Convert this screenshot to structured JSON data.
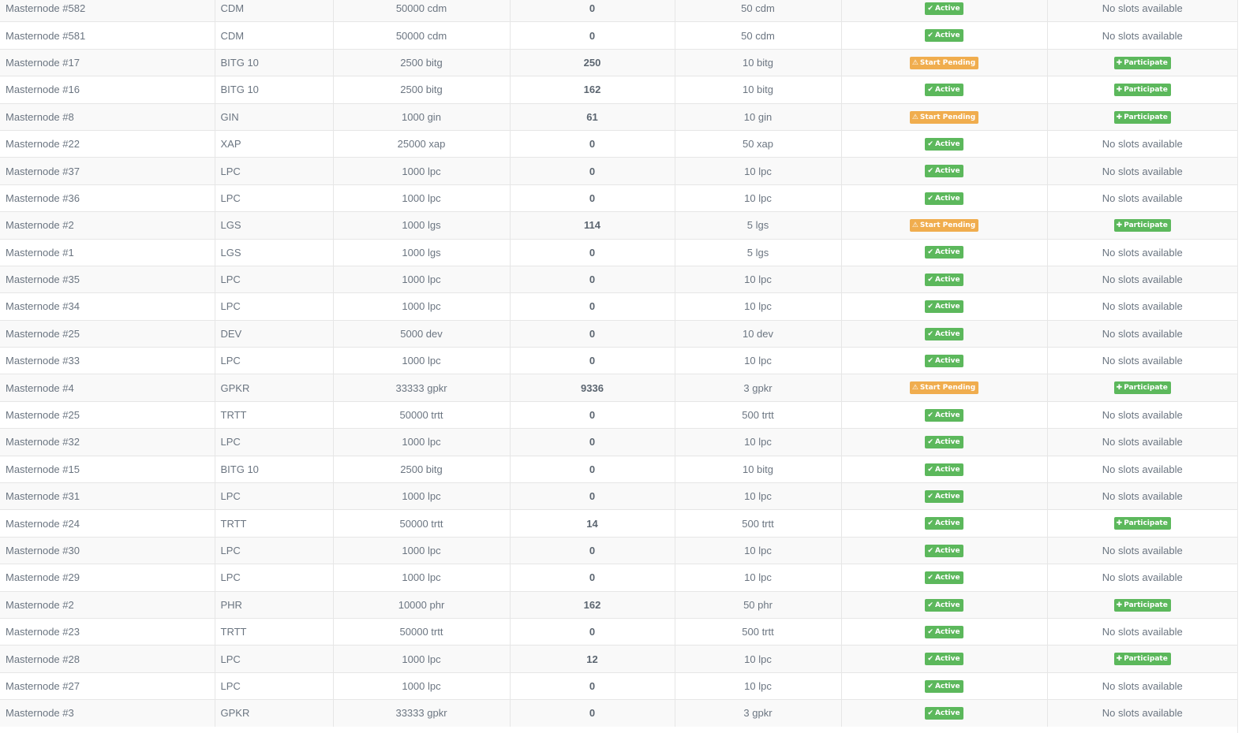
{
  "labels": {
    "active": "Active",
    "start_pending": "Start Pending",
    "participate": "Participate",
    "no_slots": "No slots available"
  },
  "icons": {
    "active": "check-icon",
    "start_pending": "warning-icon",
    "participate": "plus-icon"
  },
  "colors": {
    "active": "#5cb85c",
    "pending": "#f0ad4e",
    "participate": "#5cb85c"
  },
  "rows": [
    {
      "name": "Masternode #582",
      "coin": "CDM",
      "collateral": "50000 cdm",
      "slots": "0",
      "min": "50 cdm",
      "status": "active",
      "action": "none"
    },
    {
      "name": "Masternode #581",
      "coin": "CDM",
      "collateral": "50000 cdm",
      "slots": "0",
      "min": "50 cdm",
      "status": "active",
      "action": "none"
    },
    {
      "name": "Masternode #17",
      "coin": "BITG 10",
      "collateral": "2500 bitg",
      "slots": "250",
      "min": "10 bitg",
      "status": "pending",
      "action": "participate"
    },
    {
      "name": "Masternode #16",
      "coin": "BITG 10",
      "collateral": "2500 bitg",
      "slots": "162",
      "min": "10 bitg",
      "status": "active",
      "action": "participate"
    },
    {
      "name": "Masternode #8",
      "coin": "GIN",
      "collateral": "1000 gin",
      "slots": "61",
      "min": "10 gin",
      "status": "pending",
      "action": "participate"
    },
    {
      "name": "Masternode #22",
      "coin": "XAP",
      "collateral": "25000 xap",
      "slots": "0",
      "min": "50 xap",
      "status": "active",
      "action": "none"
    },
    {
      "name": "Masternode #37",
      "coin": "LPC",
      "collateral": "1000 lpc",
      "slots": "0",
      "min": "10 lpc",
      "status": "active",
      "action": "none"
    },
    {
      "name": "Masternode #36",
      "coin": "LPC",
      "collateral": "1000 lpc",
      "slots": "0",
      "min": "10 lpc",
      "status": "active",
      "action": "none"
    },
    {
      "name": "Masternode #2",
      "coin": "LGS",
      "collateral": "1000 lgs",
      "slots": "114",
      "min": "5 lgs",
      "status": "pending",
      "action": "participate"
    },
    {
      "name": "Masternode #1",
      "coin": "LGS",
      "collateral": "1000 lgs",
      "slots": "0",
      "min": "5 lgs",
      "status": "active",
      "action": "none"
    },
    {
      "name": "Masternode #35",
      "coin": "LPC",
      "collateral": "1000 lpc",
      "slots": "0",
      "min": "10 lpc",
      "status": "active",
      "action": "none"
    },
    {
      "name": "Masternode #34",
      "coin": "LPC",
      "collateral": "1000 lpc",
      "slots": "0",
      "min": "10 lpc",
      "status": "active",
      "action": "none"
    },
    {
      "name": "Masternode #25",
      "coin": "DEV",
      "collateral": "5000 dev",
      "slots": "0",
      "min": "10 dev",
      "status": "active",
      "action": "none"
    },
    {
      "name": "Masternode #33",
      "coin": "LPC",
      "collateral": "1000 lpc",
      "slots": "0",
      "min": "10 lpc",
      "status": "active",
      "action": "none"
    },
    {
      "name": "Masternode #4",
      "coin": "GPKR",
      "collateral": "33333 gpkr",
      "slots": "9336",
      "min": "3 gpkr",
      "status": "pending",
      "action": "participate"
    },
    {
      "name": "Masternode #25",
      "coin": "TRTT",
      "collateral": "50000 trtt",
      "slots": "0",
      "min": "500 trtt",
      "status": "active",
      "action": "none"
    },
    {
      "name": "Masternode #32",
      "coin": "LPC",
      "collateral": "1000 lpc",
      "slots": "0",
      "min": "10 lpc",
      "status": "active",
      "action": "none"
    },
    {
      "name": "Masternode #15",
      "coin": "BITG 10",
      "collateral": "2500 bitg",
      "slots": "0",
      "min": "10 bitg",
      "status": "active",
      "action": "none"
    },
    {
      "name": "Masternode #31",
      "coin": "LPC",
      "collateral": "1000 lpc",
      "slots": "0",
      "min": "10 lpc",
      "status": "active",
      "action": "none"
    },
    {
      "name": "Masternode #24",
      "coin": "TRTT",
      "collateral": "50000 trtt",
      "slots": "14",
      "min": "500 trtt",
      "status": "active",
      "action": "participate"
    },
    {
      "name": "Masternode #30",
      "coin": "LPC",
      "collateral": "1000 lpc",
      "slots": "0",
      "min": "10 lpc",
      "status": "active",
      "action": "none"
    },
    {
      "name": "Masternode #29",
      "coin": "LPC",
      "collateral": "1000 lpc",
      "slots": "0",
      "min": "10 lpc",
      "status": "active",
      "action": "none"
    },
    {
      "name": "Masternode #2",
      "coin": "PHR",
      "collateral": "10000 phr",
      "slots": "162",
      "min": "50 phr",
      "status": "active",
      "action": "participate"
    },
    {
      "name": "Masternode #23",
      "coin": "TRTT",
      "collateral": "50000 trtt",
      "slots": "0",
      "min": "500 trtt",
      "status": "active",
      "action": "none"
    },
    {
      "name": "Masternode #28",
      "coin": "LPC",
      "collateral": "1000 lpc",
      "slots": "12",
      "min": "10 lpc",
      "status": "active",
      "action": "participate"
    },
    {
      "name": "Masternode #27",
      "coin": "LPC",
      "collateral": "1000 lpc",
      "slots": "0",
      "min": "10 lpc",
      "status": "active",
      "action": "none"
    },
    {
      "name": "Masternode #3",
      "coin": "GPKR",
      "collateral": "33333 gpkr",
      "slots": "0",
      "min": "3 gpkr",
      "status": "active",
      "action": "none"
    }
  ]
}
